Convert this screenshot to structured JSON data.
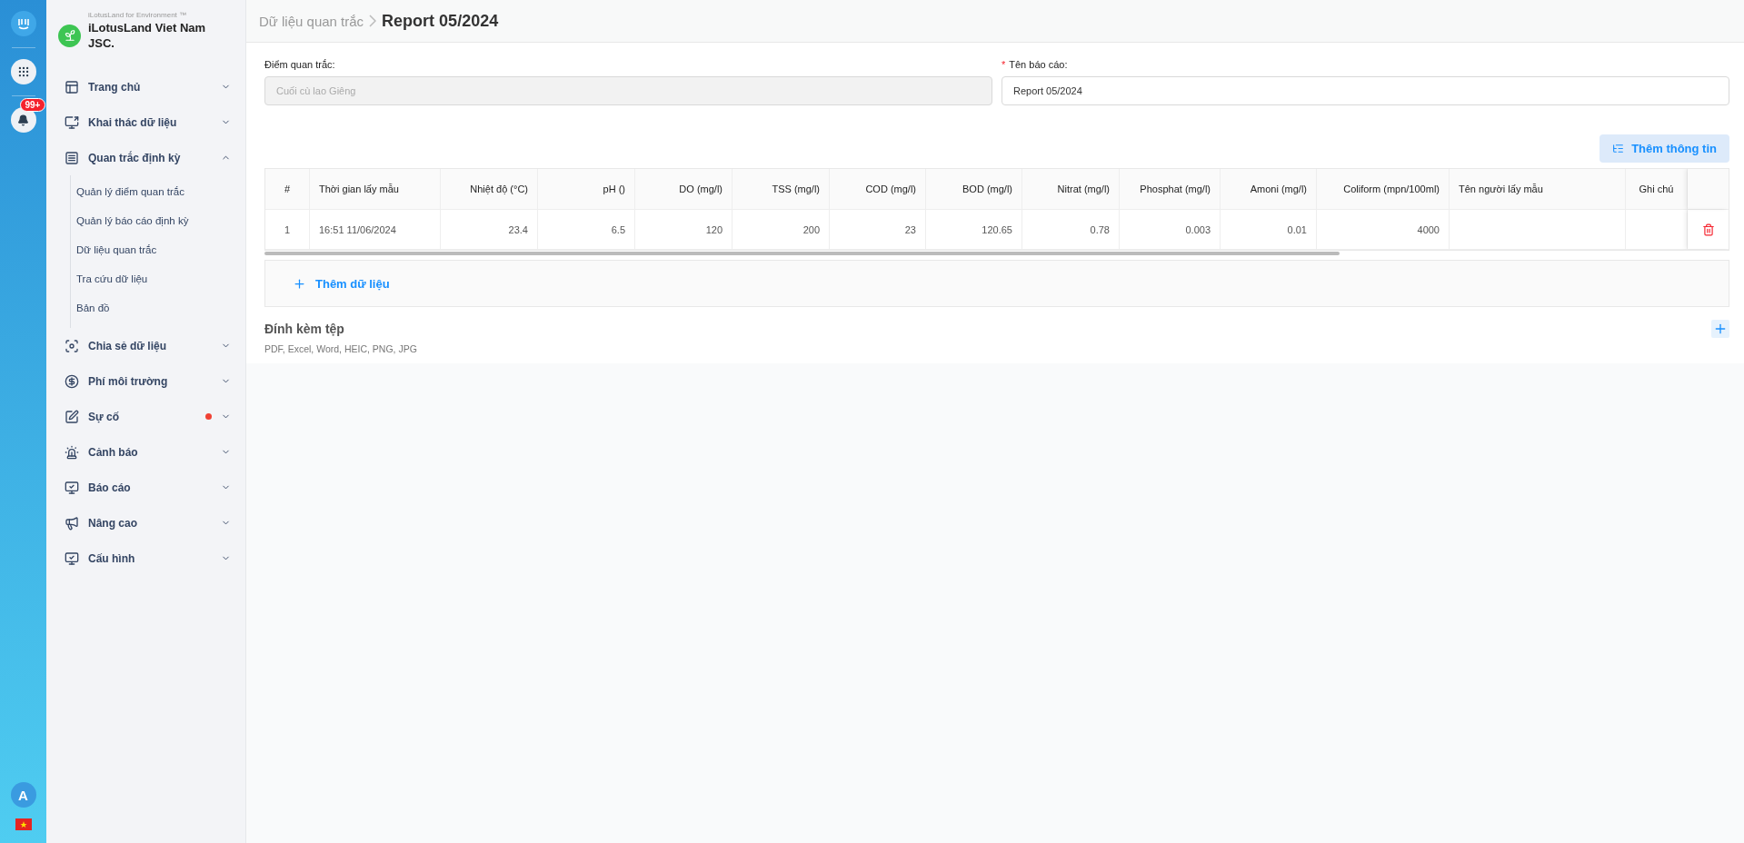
{
  "rail": {
    "notifications": "99+",
    "avatar": "A"
  },
  "brand": {
    "tagline": "iLotusLand for Environment ™",
    "name": "iLotusLand Viet Nam JSC."
  },
  "nav": [
    {
      "label": "Trang chủ",
      "expanded": false,
      "alert": false
    },
    {
      "label": "Khai thác dữ liệu",
      "expanded": false,
      "alert": false
    },
    {
      "label": "Quan trắc định kỳ",
      "expanded": true,
      "alert": false,
      "children": [
        {
          "label": "Quản lý điểm quan trắc",
          "selected": false
        },
        {
          "label": "Quản lý báo cáo định kỳ",
          "selected": false
        },
        {
          "label": "Dữ liệu quan trắc",
          "selected": false
        },
        {
          "label": "Tra cứu dữ liệu",
          "selected": false
        },
        {
          "label": "Bản đồ",
          "selected": false
        }
      ]
    },
    {
      "label": "Chia sẻ dữ liệu",
      "expanded": false,
      "alert": false
    },
    {
      "label": "Phí môi trường",
      "expanded": false,
      "alert": false
    },
    {
      "label": "Sự cố",
      "expanded": false,
      "alert": true
    },
    {
      "label": "Cảnh báo",
      "expanded": false,
      "alert": false
    },
    {
      "label": "Báo cáo",
      "expanded": false,
      "alert": false
    },
    {
      "label": "Nâng cao",
      "expanded": false,
      "alert": false
    },
    {
      "label": "Cấu hình",
      "expanded": false,
      "alert": false
    }
  ],
  "breadcrumb": {
    "parent": "Dữ liệu quan trắc",
    "current": "Report 05/2024"
  },
  "fields": [
    {
      "label": "Điểm quan trắc:",
      "value": "Cuối cù lao Giêng",
      "disabled": true
    },
    {
      "required_mark": "*",
      "label": "Tên báo cáo:",
      "value": "Report 05/2024",
      "disabled": false
    }
  ],
  "add_info_button": "Thêm thông tin",
  "table": {
    "columns": [
      "#",
      "Thời gian lấy mẫu",
      "Nhiệt độ (°C)",
      "pH ()",
      "DO (mg/l)",
      "TSS (mg/l)",
      "COD (mg/l)",
      "BOD (mg/l)",
      "Nitrat (mg/l)",
      "Phosphat (mg/l)",
      "Amoni (mg/l)",
      "Coliform (mpn/100ml)",
      "Tên người lấy mẫu",
      "Ghi chú"
    ],
    "rows": [
      {
        "cells": [
          "1",
          "16:51 11/06/2024",
          "23.4",
          "6.5",
          "120",
          "200",
          "23",
          "120.65",
          "0.78",
          "0.003",
          "0.01",
          "4000"
        ]
      }
    ],
    "add_row": "Thêm dữ liệu"
  },
  "attachments": {
    "title": "Đính kèm tệp",
    "formats": "PDF, Excel, Word, HEIC, PNG, JPG"
  }
}
